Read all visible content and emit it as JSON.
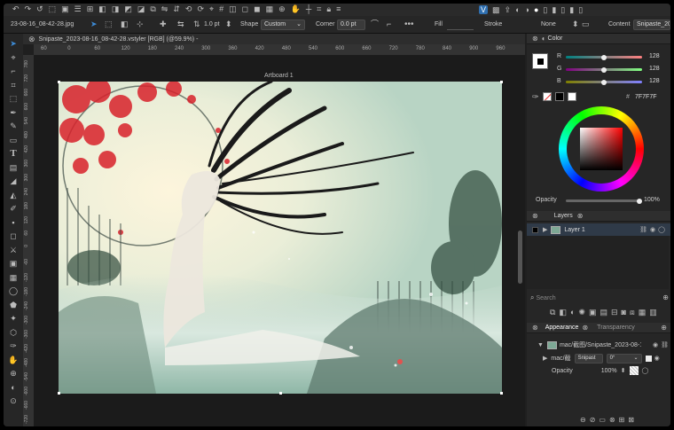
{
  "context": {
    "filename": "23-08-16_08-42-28.jpg",
    "stroke_width": "1.0 pt",
    "shape_label": "Shape",
    "shape_value": "Custom",
    "corner_label": "Corner",
    "corner_value": "0.0 pt",
    "fill_label": "Fill",
    "stroke_label": "Stroke",
    "stroke_value": "None",
    "content_label": "Content",
    "content_value": "Snipaste_20"
  },
  "document": {
    "tab_title": "Snipaste_2023-08-16_08-42-28.vstyler [RGB] (@59.9%) -",
    "artboard_label": "Artboard 1",
    "ruler_top": [
      "60",
      "0",
      "60",
      "120",
      "180",
      "240",
      "300",
      "360",
      "420",
      "480",
      "540",
      "600",
      "660",
      "720",
      "780",
      "840",
      "900",
      "960"
    ],
    "ruler_left": [
      "780",
      "720",
      "660",
      "600",
      "540",
      "480",
      "420",
      "360",
      "300",
      "240",
      "180",
      "120",
      "60",
      "0",
      "-60",
      "-120",
      "-180",
      "-240",
      "-300",
      "-360",
      "-420",
      "-480",
      "-540",
      "-600",
      "-660",
      "-720"
    ]
  },
  "color_panel": {
    "title": "Color",
    "channels": [
      {
        "name": "R",
        "value": "128",
        "fraction": 0.5
      },
      {
        "name": "G",
        "value": "128",
        "fraction": 0.5
      },
      {
        "name": "B",
        "value": "128",
        "fraction": 0.5
      }
    ],
    "hex_label": "#",
    "hex_value": "7F7F7F",
    "opacity_label": "Opacity",
    "opacity_value": "100%"
  },
  "layers_panel": {
    "title": "Layers",
    "layer_name": "Layer 1",
    "search_placeholder": "Search"
  },
  "appearance_panel": {
    "tab_appearance": "Appearance",
    "tab_transparency": "Transparency",
    "item_path": "mac/截图/Snipaste_2023-08-1",
    "sub_item": "mac/截",
    "sub_select": "Snipast",
    "sub_angle": "0°",
    "opacity_label": "Opacity",
    "opacity_value": "100%"
  },
  "colors": {
    "accent": "#3d8bd6",
    "panel_bg": "#262626",
    "selected_swatch": "#7F7F7F"
  }
}
